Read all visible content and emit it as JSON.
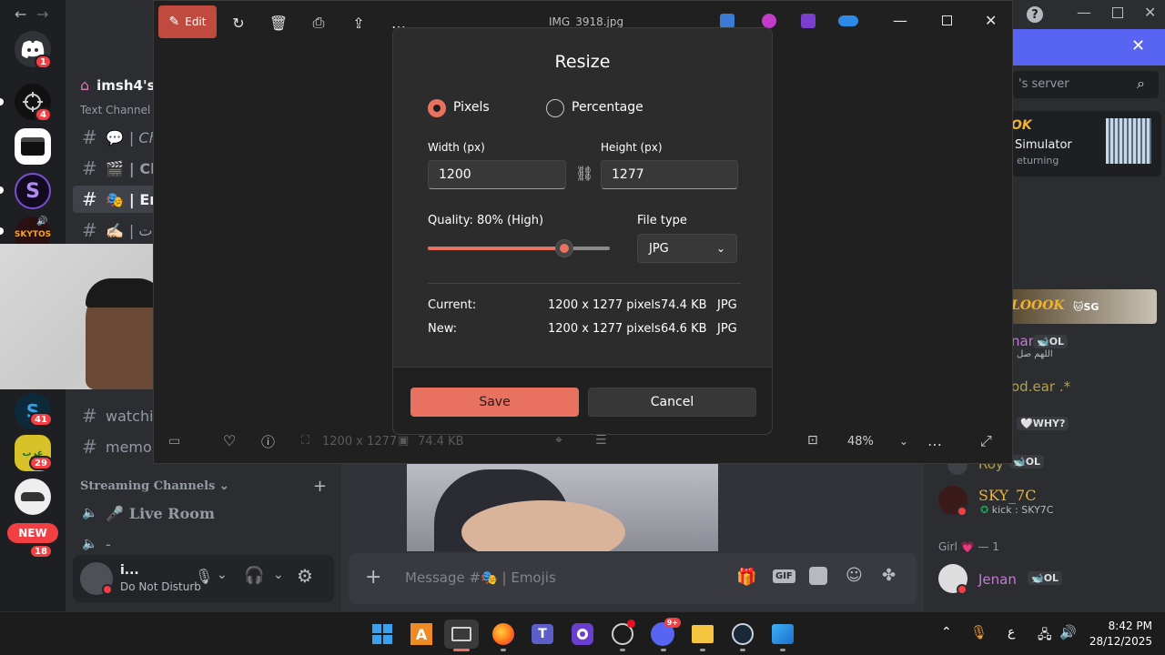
{
  "viewer": {
    "edit_label": "Edit",
    "file_name": "IMG_3918.jpg",
    "dimensions": "1200 x 1277",
    "size": "74.4 KB",
    "zoom": "48%"
  },
  "dialog": {
    "title": "Resize",
    "radio_pixels": "Pixels",
    "radio_percentage": "Percentage",
    "width_label": "Width  (px)",
    "height_label": "Height  (px)",
    "width_value": "1200",
    "height_value": "1277",
    "quality_label": "Quality: 80% (High)",
    "quality_fraction": 0.8,
    "filetype_label": "File type",
    "filetype_value": "JPG",
    "current_label": "Current:",
    "current_dims": "1200 x 1277 pixels",
    "current_size": "74.4 KB",
    "current_type": "JPG",
    "new_label": "New:",
    "new_dims": "1200 x 1277 pixels",
    "new_size": "64.6 KB",
    "new_type": "JPG",
    "save_label": "Save",
    "cancel_label": "Cancel"
  },
  "discord": {
    "rail_badges": [
      "1",
      "4",
      "41",
      "29",
      "18"
    ],
    "new_badge": "NEW",
    "server_name": "imsh4's",
    "text_channels": "Text Channel",
    "channels": [
      {
        "icon": "💬",
        "name": "| Ch"
      },
      {
        "icon": "🎬",
        "name": "| Cli"
      },
      {
        "icon": "🎭",
        "name": "| Em"
      },
      {
        "icon": "✍🏻",
        "name": "| جات"
      }
    ],
    "watch_channel": "watchin",
    "memories_channel": "memori",
    "streaming_header": "Streaming Channels",
    "live_room": "Live Room",
    "voice_dash": "-",
    "user_name": "i...",
    "user_status": "Do Not Disturb",
    "message_placeholder": "Message #🎭 | Emojis",
    "search_placeholder": "'s server"
  },
  "members_panel": {
    "promo_title": "OK",
    "promo_line1": "Simulator",
    "promo_line2": "eturning",
    "banner_name": "LOOOK",
    "banner_tag": "SG",
    "m1_name": "nan",
    "m1_tag": "OL",
    "m1_sub": "اللهم صل",
    "m2_text": "od.ear .*",
    "m3_tag": "WHY?",
    "m4_name": "Roy",
    "m4_tag": "OL",
    "m5_name": "SKY_7C",
    "m5_sub": "kick : SKY7C",
    "group_label": "Girl 💗 — 1",
    "m6_name": "Jenan",
    "m6_tag": "OL"
  },
  "taskbar": {
    "lang": "ع",
    "time": "8:42 PM",
    "date": "28/12/2025",
    "discord_badge": "9+"
  }
}
